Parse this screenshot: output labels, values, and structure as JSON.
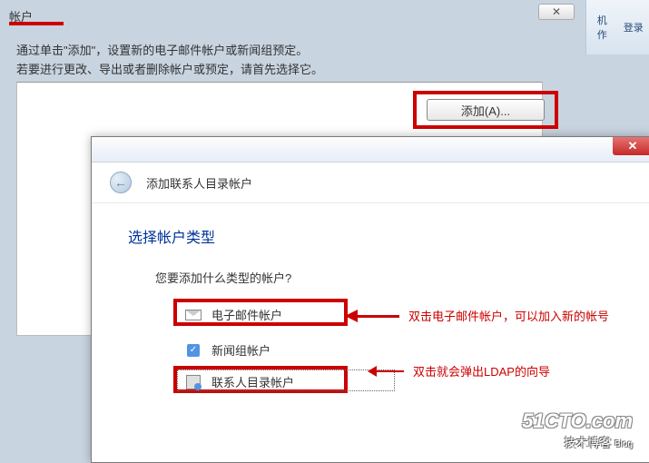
{
  "tabs": {
    "active": "帐户"
  },
  "instr": {
    "line1": "通过单击\"添加\"，设置新的电子邮件帐户或新闻组预定。",
    "line2": "若要进行更改、导出或者删除帐户或预定，请首先选择它。"
  },
  "buttons": {
    "add": "添加(A)..."
  },
  "toolbar_right": {
    "item1": "机",
    "item1b": "作",
    "item2": "登录"
  },
  "wizard": {
    "title": "添加联系人目录帐户",
    "section": "选择帐户类型",
    "question": "您要添加什么类型的帐户?",
    "options": {
      "email": "电子邮件帐户",
      "news": "新闻组帐户",
      "dir": "联系人目录帐户"
    }
  },
  "annotations": {
    "email": "双击电子邮件帐户，可以加入新的帐号",
    "dir": "双击就会弹出LDAP的向导"
  },
  "watermark": {
    "line1": "51CTO.com",
    "line2": "技术博客",
    "blog": "Blog"
  },
  "glyphs": {
    "close": "✕",
    "back": "←"
  }
}
